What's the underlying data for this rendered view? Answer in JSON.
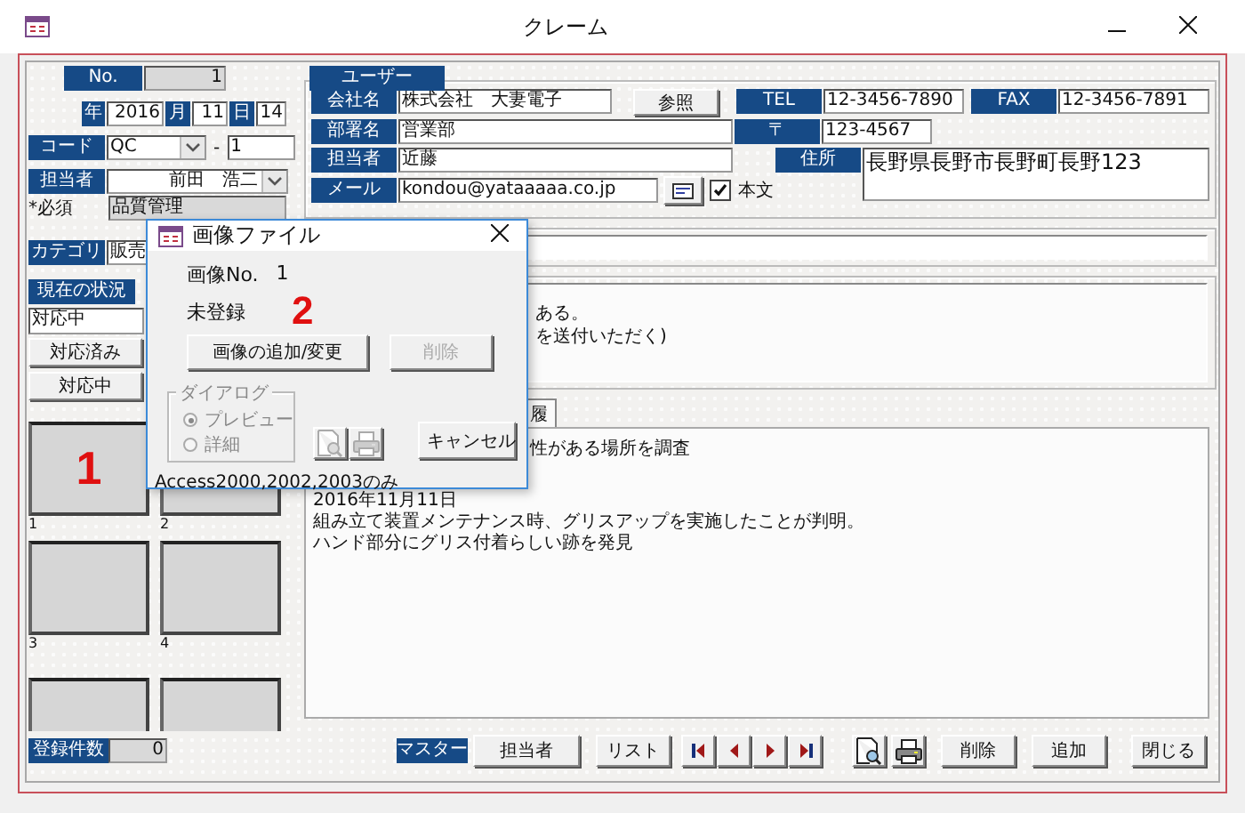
{
  "window": {
    "title": "クレーム"
  },
  "record": {
    "no_label": "No.",
    "no": "1",
    "year_label": "年",
    "year": "2016",
    "month_label": "月",
    "month": "11",
    "day_label": "日",
    "day": "14",
    "code_label": "コード",
    "code": "QC",
    "code_sep": "-",
    "code_no": "1",
    "staff_label": "担当者",
    "staff": "前田　浩二",
    "required_note": "*必須",
    "department": "品質管理",
    "category_label": "カテゴリ",
    "category": "販売",
    "status_label": "現在の状況",
    "status": "対応中",
    "status_buttons": [
      "対応済み",
      "対応中"
    ]
  },
  "image_tiles": [
    {
      "kind": "full",
      "caption": "1",
      "marker": "1"
    },
    {
      "kind": "full",
      "caption": "2"
    },
    {
      "kind": "full",
      "caption": "3"
    },
    {
      "kind": "full",
      "caption": "4"
    },
    {
      "kind": "cut"
    },
    {
      "kind": "cut"
    }
  ],
  "count": {
    "label": "登録件数",
    "value": "0"
  },
  "user": {
    "title": "ユーザー",
    "company_label": "会社名",
    "company": "株式会社　大妻電子",
    "browse_button": "参照",
    "tel_label": "TEL",
    "tel": "12-3456-7890",
    "fax_label": "FAX",
    "fax": "12-3456-7891",
    "dept_label": "部署名",
    "dept": "営業部",
    "zip_label": "〒",
    "zip": "123-4567",
    "contact_label": "担当者",
    "contact": "近藤",
    "address_label": "住所",
    "address": "長野県長野市長野町長野123",
    "mail_label": "メール",
    "mail": "kondou@yataaaaa.co.jp",
    "body_checkbox": {
      "label": "本文",
      "checked": true
    }
  },
  "summary_lines": [
    "ある。",
    "を送付いただく)"
  ],
  "tabs": [
    {
      "label": "履",
      "selected": true
    }
  ],
  "notes": [
    {
      "lines": [
        "性がある場所を調査"
      ]
    },
    {
      "lines": [
        "2016年11月11日",
        "組み立て装置メンテナンス時、グリスアップを実施したことが判明。",
        "ハンド部分にグリス付着らしい跡を発見"
      ]
    }
  ],
  "toolbar": {
    "master_label": "マスター",
    "master_button": "担当者",
    "list_button": "リスト",
    "actions": [
      "削除",
      "追加",
      "閉じる"
    ]
  },
  "dialog": {
    "title": "画像ファイル",
    "image_no_label": "画像No.",
    "image_no": "1",
    "status": "未登録",
    "marker": "2",
    "add_button": "画像の追加/変更",
    "delete_button": {
      "label": "削除",
      "disabled": true
    },
    "group": {
      "title": "ダイアログ",
      "disabled": true,
      "options": [
        {
          "label": "プレビュー",
          "selected": true
        },
        {
          "label": "詳細",
          "selected": false
        }
      ]
    },
    "cancel_button": "キャンセル",
    "note": "Access2000,2002,2003のみ"
  }
}
